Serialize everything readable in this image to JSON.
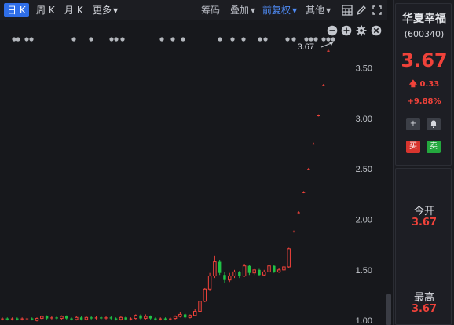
{
  "toolbar": {
    "periods": [
      "日 K",
      "周 K",
      "月 K",
      "更多"
    ],
    "tools": [
      "筹码",
      "叠加",
      "前复权",
      "其他"
    ],
    "active_tool": "前复权"
  },
  "chart": {
    "price_tag": "3.67",
    "y_ticks": [
      "3.50",
      "3.00",
      "2.50",
      "2.00",
      "1.50",
      "1.00"
    ],
    "ylim": [
      0.97,
      3.73
    ],
    "colors": {
      "up": "#f0423a",
      "down": "#1fc246",
      "background": "#17181c"
    }
  },
  "chart_data": {
    "type": "candlestick",
    "ylim": [
      0.97,
      3.73
    ],
    "y_ticks": [
      1.0,
      1.5,
      2.0,
      2.5,
      3.0,
      3.5
    ],
    "last_price": 3.67,
    "candles": [
      {
        "o": 1.01,
        "c": 1.02,
        "h": 1.03,
        "l": 1.0
      },
      {
        "o": 1.02,
        "c": 1.01,
        "h": 1.03,
        "l": 1.0
      },
      {
        "o": 1.01,
        "c": 1.02,
        "h": 1.03,
        "l": 1.0
      },
      {
        "o": 1.02,
        "c": 1.01,
        "h": 1.03,
        "l": 1.0
      },
      {
        "o": 1.01,
        "c": 1.02,
        "h": 1.03,
        "l": 1.0
      },
      {
        "o": 1.02,
        "c": 1.02,
        "h": 1.03,
        "l": 1.01
      },
      {
        "o": 1.02,
        "c": 1.01,
        "h": 1.03,
        "l": 1.0
      },
      {
        "o": 1.0,
        "c": 1.02,
        "h": 1.03,
        "l": 0.99
      },
      {
        "o": 1.02,
        "c": 1.04,
        "h": 1.05,
        "l": 1.01
      },
      {
        "o": 1.04,
        "c": 1.02,
        "h": 1.05,
        "l": 1.01
      },
      {
        "o": 1.02,
        "c": 1.03,
        "h": 1.04,
        "l": 1.01
      },
      {
        "o": 1.03,
        "c": 1.02,
        "h": 1.04,
        "l": 1.01
      },
      {
        "o": 1.02,
        "c": 1.04,
        "h": 1.05,
        "l": 1.01
      },
      {
        "o": 1.04,
        "c": 1.02,
        "h": 1.05,
        "l": 1.01
      },
      {
        "o": 1.02,
        "c": 1.01,
        "h": 1.03,
        "l": 1.0
      },
      {
        "o": 1.01,
        "c": 1.03,
        "h": 1.04,
        "l": 1.0
      },
      {
        "o": 1.03,
        "c": 1.01,
        "h": 1.04,
        "l": 1.0
      },
      {
        "o": 1.01,
        "c": 1.03,
        "h": 1.04,
        "l": 1.0
      },
      {
        "o": 1.03,
        "c": 1.02,
        "h": 1.04,
        "l": 1.01
      },
      {
        "o": 1.02,
        "c": 1.03,
        "h": 1.04,
        "l": 1.01
      },
      {
        "o": 1.03,
        "c": 1.02,
        "h": 1.04,
        "l": 1.01
      },
      {
        "o": 1.02,
        "c": 1.03,
        "h": 1.04,
        "l": 1.01
      },
      {
        "o": 1.03,
        "c": 1.02,
        "h": 1.04,
        "l": 1.01
      },
      {
        "o": 1.02,
        "c": 1.01,
        "h": 1.03,
        "l": 1.0
      },
      {
        "o": 1.01,
        "c": 1.03,
        "h": 1.04,
        "l": 1.0
      },
      {
        "o": 1.03,
        "c": 1.01,
        "h": 1.04,
        "l": 1.0
      },
      {
        "o": 1.01,
        "c": 1.02,
        "h": 1.03,
        "l": 1.0
      },
      {
        "o": 1.02,
        "c": 1.05,
        "h": 1.06,
        "l": 1.01
      },
      {
        "o": 1.05,
        "c": 1.02,
        "h": 1.06,
        "l": 1.01
      },
      {
        "o": 1.02,
        "c": 1.04,
        "h": 1.06,
        "l": 1.01
      },
      {
        "o": 1.04,
        "c": 1.02,
        "h": 1.05,
        "l": 1.01
      },
      {
        "o": 1.02,
        "c": 1.01,
        "h": 1.03,
        "l": 1.0
      },
      {
        "o": 1.01,
        "c": 1.02,
        "h": 1.03,
        "l": 1.0
      },
      {
        "o": 1.02,
        "c": 1.01,
        "h": 1.03,
        "l": 1.0
      },
      {
        "o": 1.01,
        "c": 1.02,
        "h": 1.03,
        "l": 1.0
      },
      {
        "o": 1.02,
        "c": 1.04,
        "h": 1.05,
        "l": 1.01
      },
      {
        "o": 1.04,
        "c": 1.06,
        "h": 1.08,
        "l": 1.03
      },
      {
        "o": 1.06,
        "c": 1.03,
        "h": 1.07,
        "l": 1.02
      },
      {
        "o": 1.03,
        "c": 1.05,
        "h": 1.06,
        "l": 1.02
      },
      {
        "o": 1.05,
        "c": 1.09,
        "h": 1.11,
        "l": 1.04
      },
      {
        "o": 1.09,
        "c": 1.19,
        "h": 1.2,
        "l": 1.08
      },
      {
        "o": 1.19,
        "c": 1.31,
        "h": 1.32,
        "l": 1.18
      },
      {
        "o": 1.31,
        "c": 1.44,
        "h": 1.47,
        "l": 1.29
      },
      {
        "o": 1.44,
        "c": 1.58,
        "h": 1.64,
        "l": 1.42
      },
      {
        "o": 1.58,
        "c": 1.47,
        "h": 1.6,
        "l": 1.45
      },
      {
        "o": 1.45,
        "c": 1.4,
        "h": 1.48,
        "l": 1.37
      },
      {
        "o": 1.4,
        "c": 1.44,
        "h": 1.47,
        "l": 1.38
      },
      {
        "o": 1.44,
        "c": 1.48,
        "h": 1.5,
        "l": 1.42
      },
      {
        "o": 1.48,
        "c": 1.44,
        "h": 1.49,
        "l": 1.42
      },
      {
        "o": 1.44,
        "c": 1.54,
        "h": 1.56,
        "l": 1.43
      },
      {
        "o": 1.54,
        "c": 1.47,
        "h": 1.55,
        "l": 1.45
      },
      {
        "o": 1.47,
        "c": 1.5,
        "h": 1.51,
        "l": 1.45
      },
      {
        "o": 1.5,
        "c": 1.45,
        "h": 1.51,
        "l": 1.44
      },
      {
        "o": 1.45,
        "c": 1.48,
        "h": 1.5,
        "l": 1.44
      },
      {
        "o": 1.48,
        "c": 1.54,
        "h": 1.55,
        "l": 1.47
      },
      {
        "o": 1.54,
        "c": 1.48,
        "h": 1.55,
        "l": 1.47
      },
      {
        "o": 1.48,
        "c": 1.5,
        "h": 1.52,
        "l": 1.47
      },
      {
        "o": 1.5,
        "c": 1.53,
        "h": 1.54,
        "l": 1.49
      },
      {
        "o": 1.53,
        "c": 1.71,
        "h": 1.72,
        "l": 1.52
      },
      {
        "o": 1.88,
        "c": 1.88,
        "h": 1.89,
        "l": 1.87
      },
      {
        "o": 2.07,
        "c": 2.07,
        "h": 2.08,
        "l": 2.06
      },
      {
        "o": 2.27,
        "c": 2.27,
        "h": 2.28,
        "l": 2.26
      },
      {
        "o": 2.5,
        "c": 2.5,
        "h": 2.51,
        "l": 2.49
      },
      {
        "o": 2.75,
        "c": 2.75,
        "h": 2.76,
        "l": 2.74
      },
      {
        "o": 3.03,
        "c": 3.03,
        "h": 3.04,
        "l": 3.02
      },
      {
        "o": 3.33,
        "c": 3.33,
        "h": 3.34,
        "l": 3.32
      },
      {
        "o": 3.67,
        "c": 3.67,
        "h": 3.68,
        "l": 3.66
      }
    ]
  },
  "stock": {
    "name": "华夏幸福",
    "code": "(600340)",
    "price": "3.67",
    "change": "0.33",
    "change_pct": "+9.88%",
    "buy_label": "买",
    "sell_label": "卖"
  },
  "stats": {
    "open_label": "今开",
    "open_value": "3.67",
    "high_label": "最高",
    "high_value": "3.67"
  }
}
